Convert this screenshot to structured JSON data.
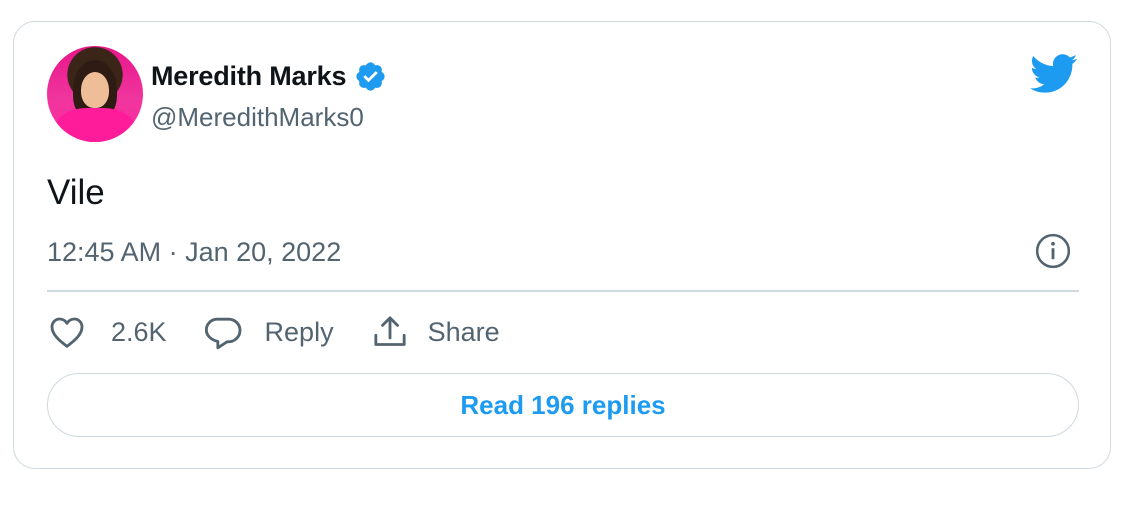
{
  "author": {
    "name": "Meredith Marks",
    "handle": "@MeredithMarks0",
    "verified": true
  },
  "tweet": {
    "text": "Vile",
    "timestamp": "12:45 AM · Jan 20, 2022"
  },
  "actions": {
    "like_count": "2.6K",
    "reply_label": "Reply",
    "share_label": "Share"
  },
  "read_replies_label": "Read 196 replies",
  "icons": {
    "verified": "verified-badge-icon",
    "brand": "twitter-bird-icon",
    "info": "info-icon",
    "like": "heart-icon",
    "reply": "speech-bubble-icon",
    "share": "share-upload-icon"
  },
  "colors": {
    "brand_blue": "#1d9bf0",
    "secondary_text": "#536471",
    "border": "#cfd9de",
    "primary_text": "#0f1419"
  }
}
